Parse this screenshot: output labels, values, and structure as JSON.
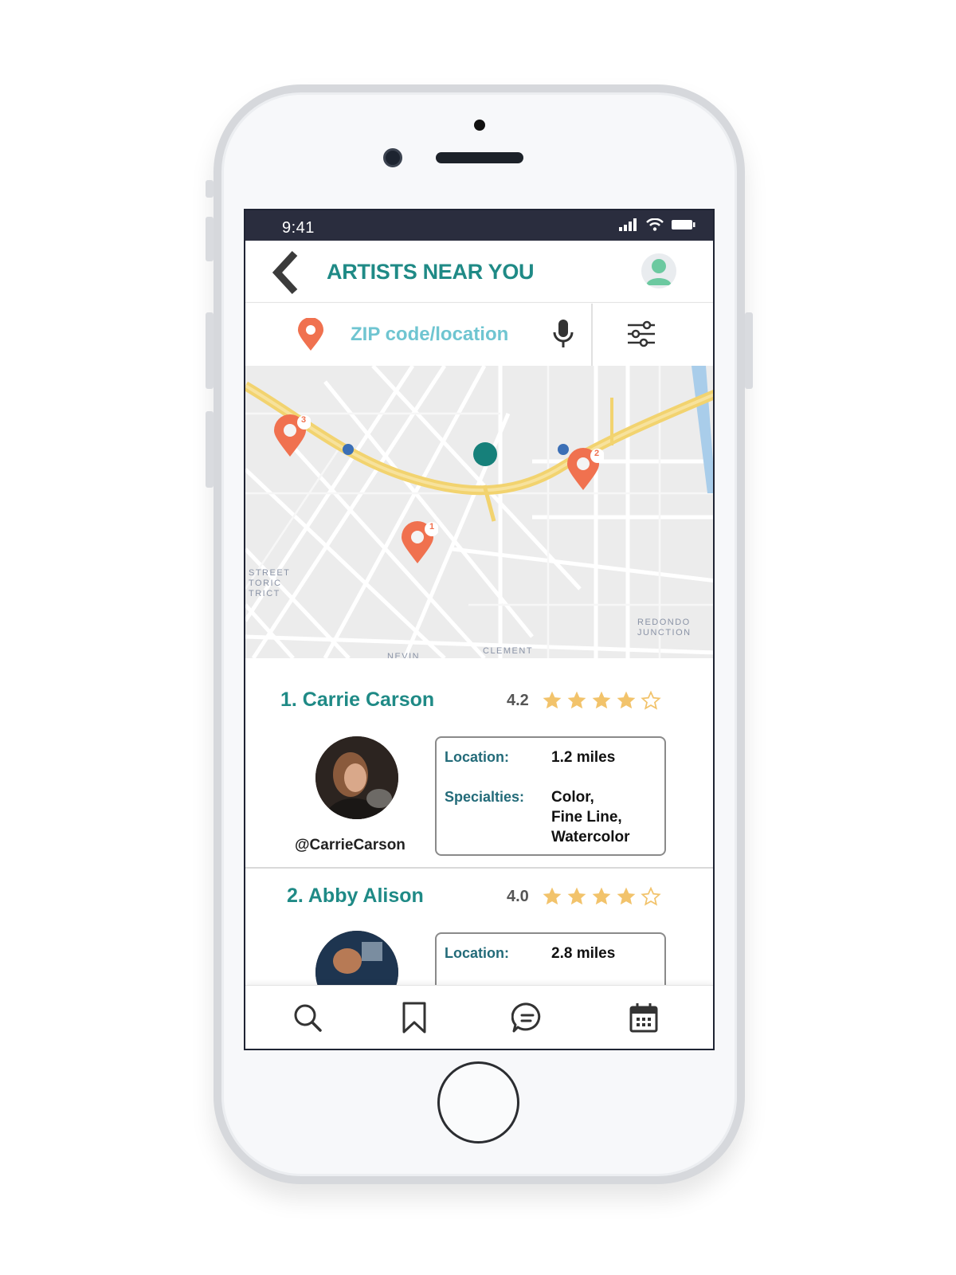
{
  "status_bar": {
    "time": "9:41"
  },
  "header": {
    "title": "ARTISTS NEAR YOU"
  },
  "search": {
    "placeholder": "ZIP code/location"
  },
  "map": {
    "labels": {
      "district": "STREET\nTORIC\nTRICT",
      "redondo": "REDONDO\nJUNCTION",
      "clement": "CLEMENT",
      "nevin": "NEVIN"
    },
    "markers": [
      {
        "number": "1"
      },
      {
        "number": "2"
      },
      {
        "number": "3"
      }
    ]
  },
  "artists": [
    {
      "name": "1. Carrie Carson",
      "rating": "4.2",
      "stars_filled": 4,
      "handle": "@CarrieCarson",
      "location_label": "Location:",
      "location_value": "1.2 miles",
      "specialties_label": "Specialties:",
      "specialties_lines": [
        "Color,",
        "Fine Line,",
        "Watercolor"
      ]
    },
    {
      "name": "2. Abby Alison",
      "rating": "4.0",
      "stars_filled": 4,
      "location_label": "Location:",
      "location_value": "2.8 miles"
    }
  ],
  "colors": {
    "accent_teal": "#1f8a86",
    "pin_orange": "#f0714f",
    "star_gold": "#f2c36b",
    "status_bar": "#2a2d3e"
  },
  "tab_bar": {
    "icons": [
      "search-icon",
      "bookmark-icon",
      "chat-icon",
      "calendar-icon"
    ]
  }
}
